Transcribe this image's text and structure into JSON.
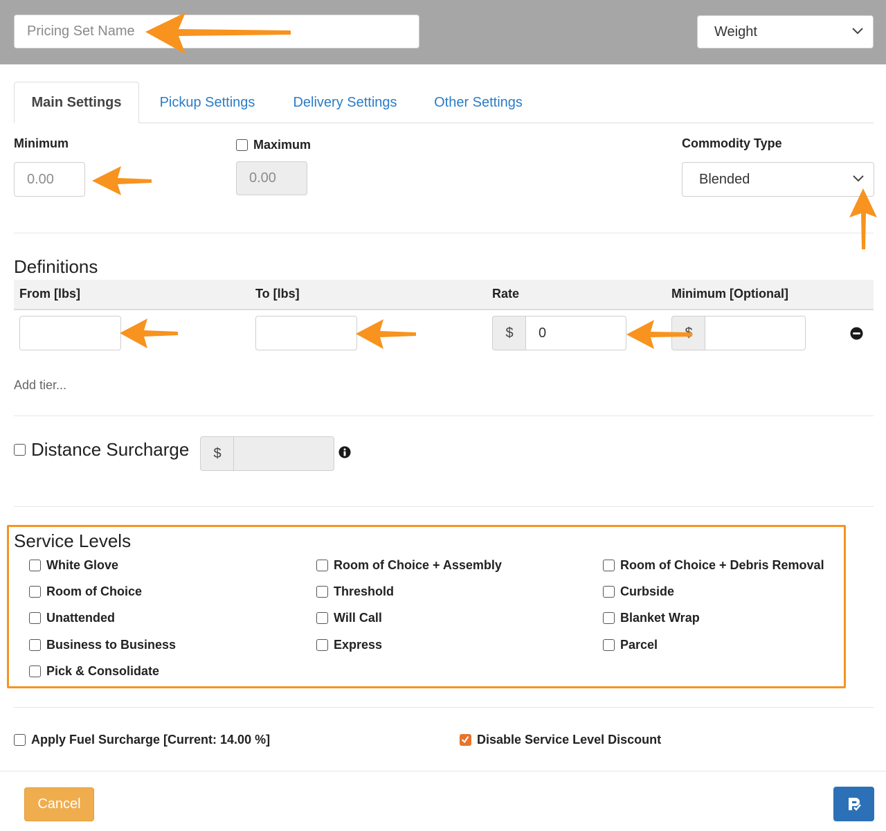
{
  "header": {
    "name_placeholder": "Pricing Set Name",
    "name_value": "",
    "type_select": "Weight"
  },
  "tabs": [
    {
      "label": "Main Settings",
      "active": true
    },
    {
      "label": "Pickup Settings",
      "active": false
    },
    {
      "label": "Delivery Settings",
      "active": false
    },
    {
      "label": "Other Settings",
      "active": false
    }
  ],
  "main": {
    "minimum_label": "Minimum",
    "minimum_value": "0.00",
    "maximum_label": "Maximum",
    "maximum_value": "0.00",
    "maximum_checked": false,
    "commodity_label": "Commodity Type",
    "commodity_value": "Blended"
  },
  "definitions": {
    "title": "Definitions",
    "columns": [
      "From [lbs]",
      "To [lbs]",
      "Rate",
      "Minimum [Optional]"
    ],
    "row": {
      "from": "",
      "to": "",
      "rate_prefix": "$",
      "rate": "0",
      "min_prefix": "$",
      "min": ""
    },
    "add_tier": "Add tier..."
  },
  "distance": {
    "label": "Distance Surcharge",
    "checked": false,
    "prefix": "$",
    "value": ""
  },
  "service_levels": {
    "title": "Service Levels",
    "items": [
      "White Glove",
      "Room of Choice + Assembly",
      "Room of Choice + Debris Removal",
      "Room of Choice",
      "Threshold",
      "Curbside",
      "Unattended",
      "Will Call",
      "Blanket Wrap",
      "Business to Business",
      "Express",
      "Parcel",
      "Pick & Consolidate"
    ]
  },
  "footer_options": {
    "fuel_label": "Apply Fuel Surcharge [Current: 14.00 %]",
    "fuel_checked": false,
    "disable_discount_label": "Disable Service Level Discount",
    "disable_discount_checked": true
  },
  "actions": {
    "cancel_label": "Cancel",
    "save_icon": "save-icon"
  },
  "colors": {
    "accent": "#2a7cc7",
    "annotation": "#f7931e",
    "cancel": "#f0ad4e",
    "save": "#2c71b7",
    "check": "#e8742b"
  }
}
